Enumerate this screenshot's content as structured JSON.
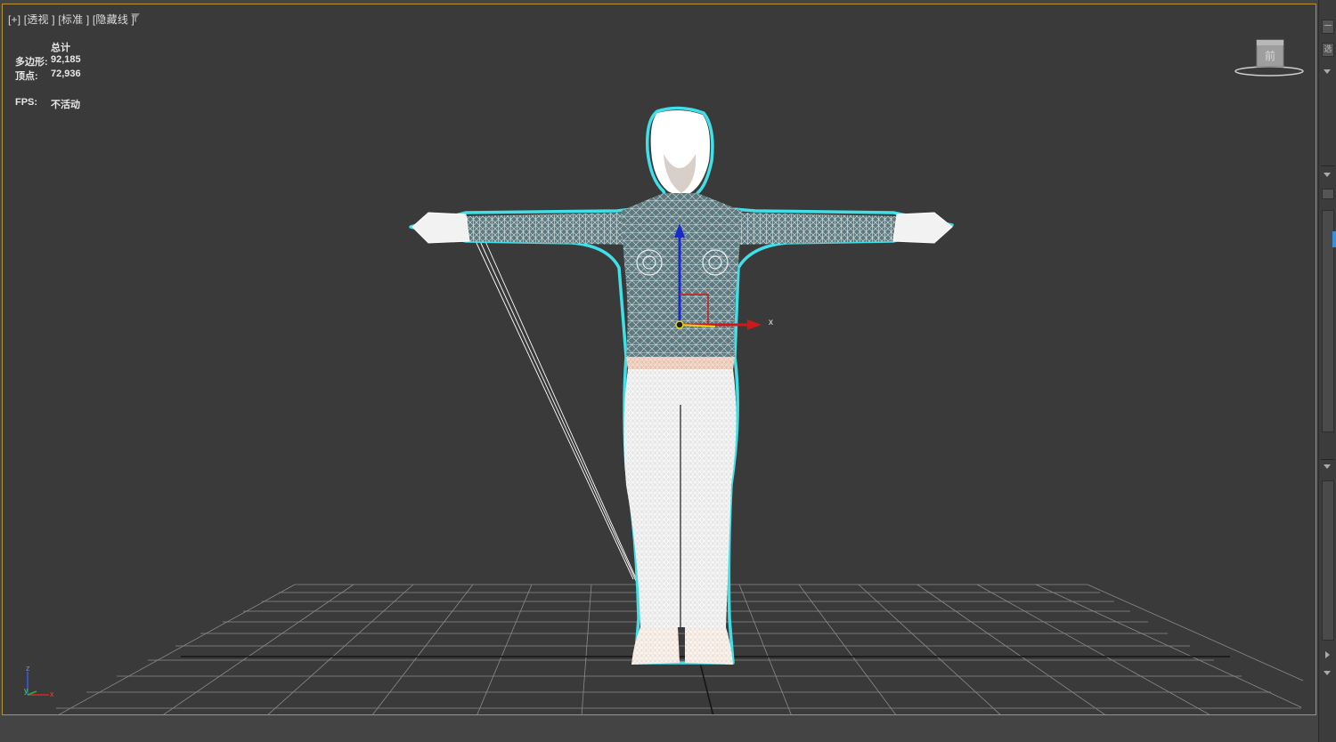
{
  "viewport": {
    "label": "[+] [透视 ] [标准 ] [隐藏线 ]",
    "stats": {
      "header": "总计",
      "poly_label": "多边形:",
      "poly_value": "92,185",
      "vert_label": "顶点:",
      "vert_value": "72,936",
      "fps_label": "FPS:",
      "fps_value": "不活动"
    },
    "gizmo_x_label": "x",
    "tripod": {
      "z": "z",
      "y": "y",
      "x": "x"
    },
    "navcube_face": "前"
  },
  "right_panel": {
    "top_button": "一",
    "tab_label": "选"
  },
  "colors": {
    "selection_outline": "#3fe0e8",
    "wire": "#ffffff",
    "gizmo_x": "#cc1a1a",
    "gizmo_y": "#e8d81a",
    "gizmo_z": "#1a2ac8",
    "viewport_border": "#b8962a"
  }
}
